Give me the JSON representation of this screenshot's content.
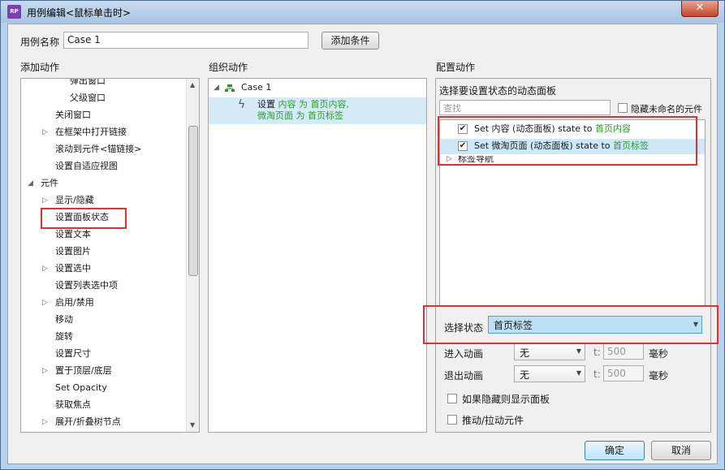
{
  "window": {
    "title": "用例编辑<鼠标单击时>",
    "app_icon": "RP",
    "close": "✕"
  },
  "case_name": {
    "label": "用例名称",
    "value": "Case 1",
    "add_condition": "添加条件"
  },
  "add_action": {
    "header": "添加动作",
    "items": [
      {
        "label": "弹出窗口"
      },
      {
        "label": "父级窗口"
      },
      {
        "label": "关闭窗口"
      },
      {
        "label": "在框架中打开链接"
      },
      {
        "label": "滚动到元件<锚链接>"
      },
      {
        "label": "设置自适应视图"
      },
      {
        "label": "元件"
      },
      {
        "label": "显示/隐藏"
      },
      {
        "label": "设置面板状态"
      },
      {
        "label": "设置文本"
      },
      {
        "label": "设置图片"
      },
      {
        "label": "设置选中"
      },
      {
        "label": "设置列表选中项"
      },
      {
        "label": "启用/禁用"
      },
      {
        "label": "移动"
      },
      {
        "label": "旋转"
      },
      {
        "label": "设置尺寸"
      },
      {
        "label": "置于顶层/底层"
      },
      {
        "label": "Set Opacity"
      },
      {
        "label": "获取焦点"
      },
      {
        "label": "展开/折叠树节点"
      }
    ]
  },
  "organize": {
    "header": "组织动作",
    "case_label": "Case 1",
    "action_prefix": "设置",
    "action_t1": "内容",
    "action_t2": "为",
    "action_t3": "首页内容,",
    "action_t4": "微淘页面",
    "action_t5": "为",
    "action_t6": "首页标签"
  },
  "configure": {
    "header": "配置动作",
    "subheader": "选择要设置状态的动态面板",
    "search_placeholder": "查找",
    "hide_unnamed": "隐藏未命名的元件",
    "rows": [
      {
        "prefix": "Set 内容 (动态面板) state to",
        "state": "首页内容",
        "checked": "✔"
      },
      {
        "prefix": "Set 微淘页面 (动态面板) state to",
        "state": "首页标签",
        "checked": "✔"
      },
      {
        "prefix": "标签导航",
        "state": ""
      }
    ],
    "select_state_label": "选择状态",
    "select_state_value": "首页标签",
    "enter_anim_label": "进入动画",
    "enter_anim_value": "无",
    "exit_anim_label": "退出动画",
    "exit_anim_value": "无",
    "t_label": "t:",
    "t_value": "500",
    "ms_label": "毫秒",
    "show_if_hidden": "如果隐藏则显示面板",
    "push_pull": "推动/拉动元件"
  },
  "footer": {
    "ok": "确定",
    "cancel": "取消"
  }
}
